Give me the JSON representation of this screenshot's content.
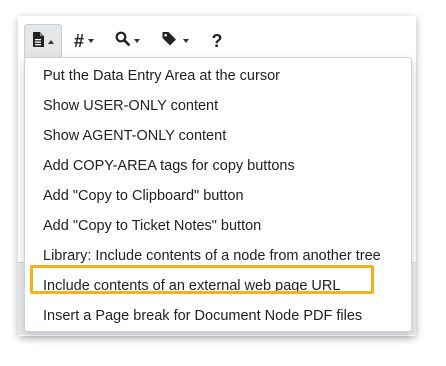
{
  "toolbar": {
    "buttons": [
      {
        "name": "document-menu",
        "icon": "document-icon",
        "caret": "up"
      },
      {
        "name": "hash-menu",
        "icon": "hash-icon",
        "glyph": "#",
        "caret": "down"
      },
      {
        "name": "search-menu",
        "icon": "search-icon",
        "caret": "down"
      },
      {
        "name": "tag-menu",
        "icon": "tag-icon",
        "caret": "down"
      },
      {
        "name": "help",
        "icon": "help-icon",
        "glyph": "?"
      }
    ]
  },
  "menu": {
    "items": [
      {
        "label": "Put the Data Entry Area at the cursor"
      },
      {
        "label": "Show USER-ONLY content"
      },
      {
        "label": "Show AGENT-ONLY content"
      },
      {
        "label": "Add COPY-AREA tags for copy buttons"
      },
      {
        "label": "Add \"Copy to Clipboard\" button"
      },
      {
        "label": "Add \"Copy to Ticket Notes\" button"
      },
      {
        "label": "Library: Include contents of a node from another tree"
      },
      {
        "label": "Include contents of an external web page URL",
        "highlighted": true
      },
      {
        "label": "Insert a Page break for Document Node PDF files"
      }
    ]
  },
  "colors": {
    "highlight": "#f2b21b",
    "active_button_bg": "#e4e6e8",
    "text": "#222222"
  }
}
